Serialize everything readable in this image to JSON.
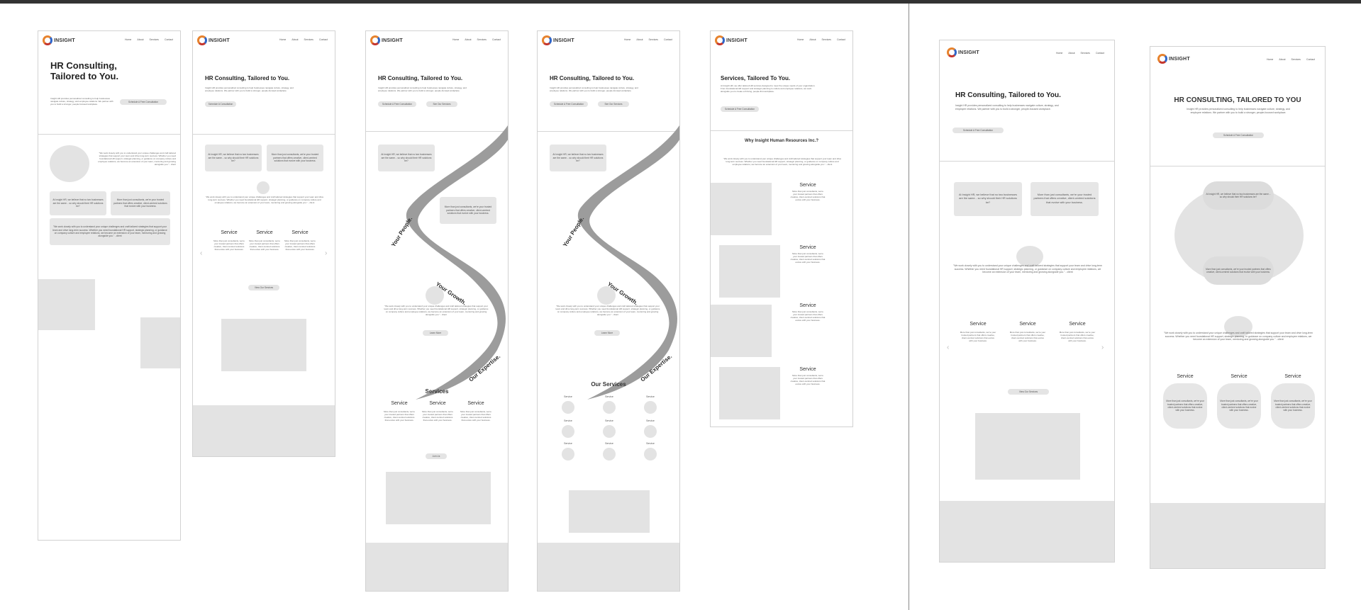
{
  "brand": {
    "logo_text": "INSIGHT",
    "colors": {
      "orange": "#e7832e",
      "blue": "#2f66c9",
      "red": "#c5352c",
      "gray": "#e3e3e3"
    }
  },
  "nav": [
    "Home",
    "About",
    "Services",
    "Contact"
  ],
  "frames": {
    "f1": {
      "title": "HR Consulting, Tailored to You.",
      "intro": "Insight HR provides personalized consulting to help businesses navigate culture, strategy, and employee relations. We partner with you to build a stronger, people-focused workplace.",
      "cta": "Schedule A Free Consultation",
      "quote": "\"We work closely with you to understand your unique challenges and craft tailored strategies that support your team and drive long-term success. Whether you need foundational HR support, strategic planning, or guidance on company culture and employee relations, we become an extension of your team, mentoring and growing alongside you.\" - client",
      "box_a": "At Insight HR, we believe that no two businesses are the same... so why should their HR solutions be?",
      "box_b": "More than just consultants, we're your trusted partners that offers creative, client-centred solutions that evolve with your business."
    },
    "f2": {
      "title": "HR Consulting, Tailored to You.",
      "intro": "Insight HR provides personalized consulting to help businesses navigate culture, strategy, and employee relations. We partner with you to build a stronger, people-focused workplace.",
      "cta": "Schedule A Consultation",
      "box_a": "At Insight HR, we believe that no two businesses are the same... so why should their HR solutions be?",
      "box_b": "More than just consultants, we're your trusted partners that offers creative, client-centred solutions that evolve with your business.",
      "quote": "\"We work closely with you to understand your unique challenges and craft tailored strategies that support your team and drive long-term success. Whether you need foundational HR support, strategic planning, or guidance on company culture and employee relations, we become an extension of your team, mentoring and growing alongside you.\" - client",
      "service_title": "Service",
      "service_desc": "More than just consultants, we're your trusted partners that offers creative, client-centred solutions that evolve with your business.",
      "view_btn": "View Our Services"
    },
    "f3": {
      "title": "HR Consulting, Tailored to You.",
      "intro": "Insight HR provides personalized consulting to help businesses navigate culture, strategy, and employee relations. We partner with you to build a stronger, people-focused workplace.",
      "cta1": "Schedule A Free Consultation",
      "cta2": "See Our Services",
      "box_a": "At Insight HR, we believe that no two businesses are the same... so why should their HR solutions be?",
      "box_b": "More than just consultants, we're your trusted partners that offers creative, client-centred solutions that evolve with your business.",
      "ribbon": [
        "Your People.",
        "Your Growth.",
        "Our Expertise."
      ],
      "quote": "\"We work closely with you to understand your unique challenges and craft tailored strategies that support your team and drive long-term success. Whether you need foundational HR support, strategic planning, or guidance on company culture and employee relations, we become an extension of your team, mentoring and growing alongside you.\" - client",
      "learn_btn": "Learn More",
      "services_heading": "Services",
      "service_title": "Service",
      "service_desc": "More than just consultants, we're your trusted partners that offers creative, client-centred solutions that evolve with your business.",
      "join_btn": "Join Us"
    },
    "f4": {
      "title": "HR Consulting, Tailored to You.",
      "intro": "Insight HR provides personalized consulting to help businesses navigate culture, strategy, and employee relations. We partner with you to build a stronger, people-focused workplace.",
      "cta1": "Schedule A Free Consultation",
      "cta2": "See Our Services",
      "box_a": "At Insight HR, we believe that no two businesses are the same... so why should their HR solutions be?",
      "box_b": "More than just consultants, we're your trusted partners that offers creative, client-centred solutions that evolve with your business.",
      "ribbon": [
        "Your People.",
        "Your Growth.",
        "Our Expertise."
      ],
      "quote": "\"We work closely with you to understand your unique challenges and craft tailored strategies that support your team and drive long-term success. Whether you need foundational HR support, strategic planning, or guidance on company culture and employee relations, we become an extension of your team, mentoring and growing alongside you.\" - client",
      "learn_btn": "Learn More",
      "services_heading": "Our Services",
      "service_title": "Service"
    },
    "f5": {
      "title": "Services, Tailored To You.",
      "intro": "At Insight HR, we offer tailored HR services designed to meet the unique needs of your organization. From foundational HR support and strategic planning to culture and employee relations, we work alongside you to create a thriving, people-first workplace.",
      "cta": "Schedule A Free Consultation",
      "why_heading": "Why Insight Human Resources Inc.?",
      "quote": "\"We work closely with you to understand your unique challenges and craft tailored strategies that support your team and drive long-term success. Whether you need foundational HR support, strategic planning, or guidance on company culture and employee relations, we become an extension of your team, mentoring and growing alongside you.\" - client",
      "service_title": "Service",
      "service_desc": "More than just consultants, we're your trusted partners that offers creative, client-centred solutions that evolve with your business."
    },
    "f6": {
      "title": "HR Consulting, Tailored to You.",
      "intro": "Insight HR provides personalized consulting to help businesses navigate culture, strategy, and employee relations. We partner with you to build a stronger, people-focused workplace.",
      "cta": "Schedule A Free Consultation",
      "box_a": "At Insight HR, we believe that no two businesses are the same... so why should their HR solutions be?",
      "box_b": "More than just consultants, we're your trusted partners that offers creative, client-centred solutions that evolve with your business.",
      "quote": "\"We work closely with you to understand your unique challenges and craft tailored strategies that support your team and drive long-term success. Whether you need foundational HR support, strategic planning, or guidance on company culture and employee relations, we become an extension of your team, mentoring and growing alongside you.\" - client",
      "service_title": "Service",
      "service_desc": "More than just consultants, we're your trusted partners that offers creative, client-centred solutions that evolve with your business.",
      "view_btn": "View Our Services"
    },
    "f7": {
      "title": "HR CONSULTING, TAILORED TO YOU",
      "intro": "Insight HR provides personalized consulting to help businesses navigate culture, strategy, and employee relations. We partner with you to build a stronger, people-focused workplace.",
      "cta": "Schedule A Free Consultation",
      "pill_a": "At Insight HR, we believe that no two businesses are the same... so why should their HR solutions be?",
      "pill_b": "More than just consultants, we're your trusted partners that offers creative, client-centred solutions that evolve with your business.",
      "quote": "\"We work closely with you to understand your unique challenges and craft tailored strategies that support your team and drive long-term success. Whether you need foundational HR support, strategic planning, or guidance on company culture and employee relations, we become an extension of your team, mentoring and growing alongside you.\" - client",
      "service_title": "Service",
      "service_desc": "More than just consultants, we're your trusted partners that offers creative, client-centred solutions that evolve with your business."
    }
  }
}
